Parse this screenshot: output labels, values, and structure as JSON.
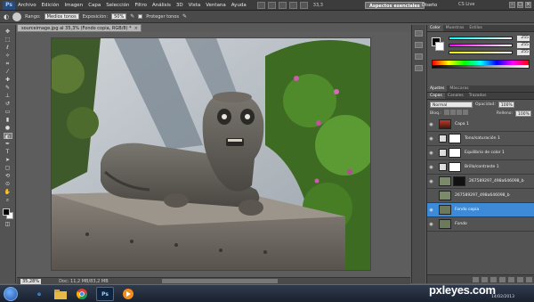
{
  "menubar": {
    "logo": "Ps",
    "items": [
      "Archivo",
      "Edición",
      "Imagen",
      "Capa",
      "Selección",
      "Filtro",
      "Análisis",
      "3D",
      "Vista",
      "Ventana",
      "Ayuda"
    ],
    "zoom": "33,3",
    "workspace_active": "Aspectos esenciales",
    "workspace_other": "Diseño",
    "cslive": "CS Live"
  },
  "options": {
    "range_label": "Rango:",
    "range_value": "Medios tonos",
    "exposure_label": "Exposición:",
    "exposure_value": "50%",
    "protect_label": "Proteger tonos"
  },
  "document": {
    "tab_title": "sourceimage.jpg al 35,3% (Fondo copia, RGB/8) *",
    "status_zoom": "35,28%",
    "status_doc": "Doc: 11,2 MB/83,2 MB"
  },
  "color_panel": {
    "tabs": [
      "Color",
      "Muestras",
      "Estilos"
    ],
    "r": "255",
    "g": "255",
    "b": "255"
  },
  "adjust_tabs": [
    "Ajustes",
    "Máscaras"
  ],
  "layers_panel": {
    "tabs": [
      "Capas",
      "Canales",
      "Trazados"
    ],
    "blend": "Normal",
    "opacity_label": "Opacidad:",
    "opacity": "100%",
    "lock_label": "Bloq.:",
    "fill_label": "Relleno:",
    "fill": "100%",
    "layers": [
      {
        "name": "Capa 1",
        "thumb": "#6b3a1f"
      },
      {
        "name": "Tono/saturación 1",
        "thumb": "#e0e0e0"
      },
      {
        "name": "Equilibrio de color 1",
        "thumb": "#e0e0e0"
      },
      {
        "name": "Brillo/contraste 1",
        "thumb": "#e0e0e0"
      },
      {
        "name": "267589297_498a646098_b",
        "thumb": "#7a8a6a"
      },
      {
        "name": "267589297_498a646098_b",
        "thumb": "#7a8a6a"
      },
      {
        "name": "Fondo copia",
        "thumb": "#6a7a5a"
      },
      {
        "name": "Fondo",
        "thumb": "#6a7a5a"
      }
    ]
  },
  "taskbar": {
    "apps": [
      "e",
      "",
      "",
      "Ps",
      ""
    ],
    "time": "",
    "date": "14/02/2013"
  },
  "watermark": "pxleyes.com",
  "watermark_date": "14/02/2013",
  "colors": {
    "accent": "#3d8bd8",
    "panel_bg": "#535353"
  }
}
